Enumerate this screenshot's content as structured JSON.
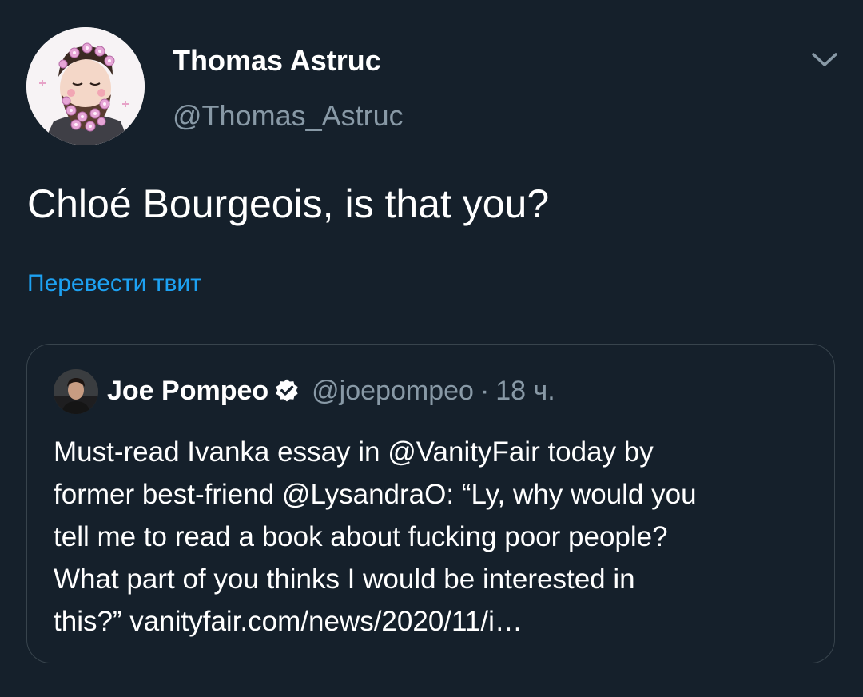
{
  "author": {
    "display_name": "Thomas Astruc",
    "handle": "@Thomas_Astruc",
    "avatar_icon": "illustrated-bearded-man-with-flowers-avatar"
  },
  "tweet": {
    "text": "Chloé Bourgeois, is that you?",
    "translate_label": "Перевести твит",
    "menu_icon": "chevron-down-icon"
  },
  "quoted_tweet": {
    "display_name": "Joe Pompeo",
    "verified": true,
    "handle": "@joepompeo",
    "separator": "·",
    "time": "18 ч.",
    "text_lines": [
      "Must-read Ivanka essay in @VanityFair today by",
      "former best-friend @LysandraO: “Ly, why would you",
      "tell me to read a book about fucking poor people?",
      "What part of you thinks I would be interested in",
      "this?” vanityfair.com/news/2020/11/i…"
    ]
  },
  "colors": {
    "background": "#15202b",
    "primary_text": "#ffffff",
    "secondary_text": "#8899a6",
    "link": "#1da1f2",
    "border": "#38444d"
  }
}
